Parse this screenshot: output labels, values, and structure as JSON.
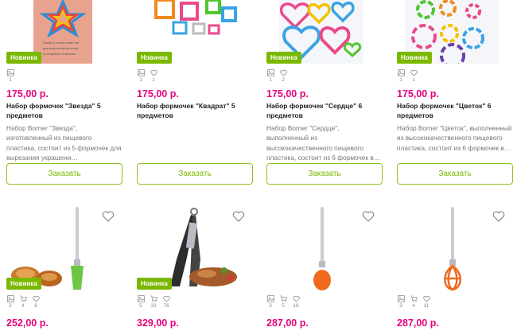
{
  "accent": "#7ab800",
  "price_color": "#e6007e",
  "row1": [
    {
      "badge": "Новинка",
      "stats": [
        "1"
      ],
      "price": "175,00 р.",
      "title": "Набор формочек \"Звезда\" 5 предметов",
      "desc": "Набор Borner \"Звезда\", изготовленный из пищевого пластика, состоит из 5 формочек для вырезания украшени…",
      "button": "Заказать",
      "image": "star-cookie-cutters"
    },
    {
      "badge": "Новинка",
      "stats": [
        "1",
        "1"
      ],
      "price": "175,00 р.",
      "title": "Набор формочек \"Квадрат\" 5 предметов",
      "desc": "",
      "button": "Заказать",
      "image": "square-cookie-cutters"
    },
    {
      "badge": "Новинка",
      "stats": [
        "1",
        "2"
      ],
      "price": "175,00 р.",
      "title": "Набор формочек \"Сердце\" 6 предметов",
      "desc": "Набор Borner \"Сердце\", выполненный из высококачественного пищевого пластика, состоит из 6 формочек в…",
      "button": "Заказать",
      "image": "heart-cookie-cutters"
    },
    {
      "badge": "Новинка",
      "stats": [
        "1",
        "1"
      ],
      "price": "175,00 р.",
      "title": "Набор формочек \"Цветок\" 6 предметов",
      "desc": "Набор Borner \"Цветок\", выполненный из высококачественного пищевого пластика, состоит из 6 формочек в…",
      "button": "Заказать",
      "image": "flower-cookie-cutters"
    }
  ],
  "row2": [
    {
      "badge": "Новинка",
      "stats": [
        "2",
        "4",
        "8"
      ],
      "price": "252,00 р.",
      "image": "green-silicone-brush"
    },
    {
      "badge": "Новинка",
      "stats": [
        "5",
        "33",
        "76"
      ],
      "price": "329,00 р.",
      "image": "black-tongs"
    },
    {
      "badge": "",
      "stats": [
        "2",
        "5",
        "18"
      ],
      "price": "287,00 р.",
      "image": "orange-spoon"
    },
    {
      "badge": "",
      "stats": [
        "3",
        "4",
        "11"
      ],
      "price": "287,00 р.",
      "image": "orange-whisk"
    }
  ]
}
